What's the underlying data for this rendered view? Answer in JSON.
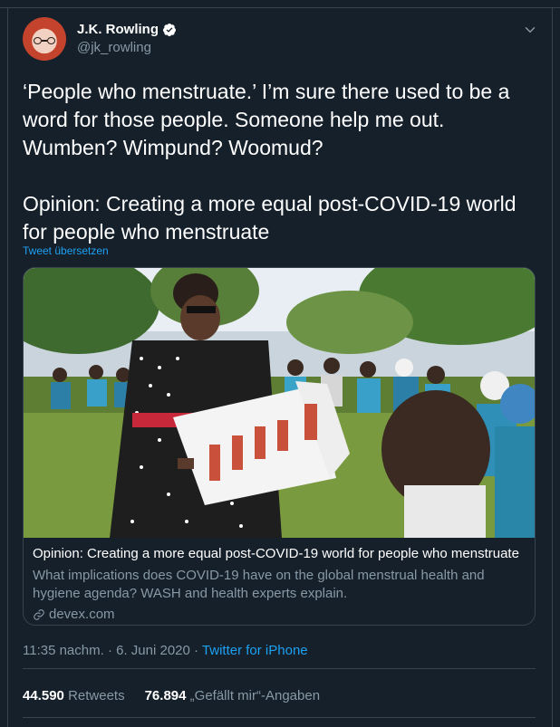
{
  "author": {
    "name": "J.K. Rowling",
    "handle": "@jk_rowling",
    "verified_icon": "verified-badge-icon"
  },
  "tweet": {
    "text": "‘People who menstruate.’ I’m sure there used to be a word for those people. Someone help me out. Wumben? Wimpund? Woomud?\n\nOpinion: Creating a more equal post-COVID-19 world for people who menstruate",
    "translate_label": "Tweet übersetzen"
  },
  "card": {
    "title": "Opinion: Creating a more equal post-COVID-19 world for people who menstruate",
    "description": "What implications does COVID-19 have on the global menstrual health and hygiene agenda? WASH and health experts explain.",
    "domain": "devex.com"
  },
  "meta": {
    "time": "11:35 nachm.",
    "separator": " · ",
    "date": "6. Juni 2020",
    "source": "Twitter for iPhone"
  },
  "stats": {
    "retweets_count": "44.590",
    "retweets_label": "Retweets",
    "likes_count": "76.894",
    "likes_label": "„Gefällt mir“-Angaben"
  },
  "colors": {
    "background": "#15202b",
    "accent": "#1da1f2",
    "secondary_text": "#8899a6",
    "border": "#38444d"
  }
}
